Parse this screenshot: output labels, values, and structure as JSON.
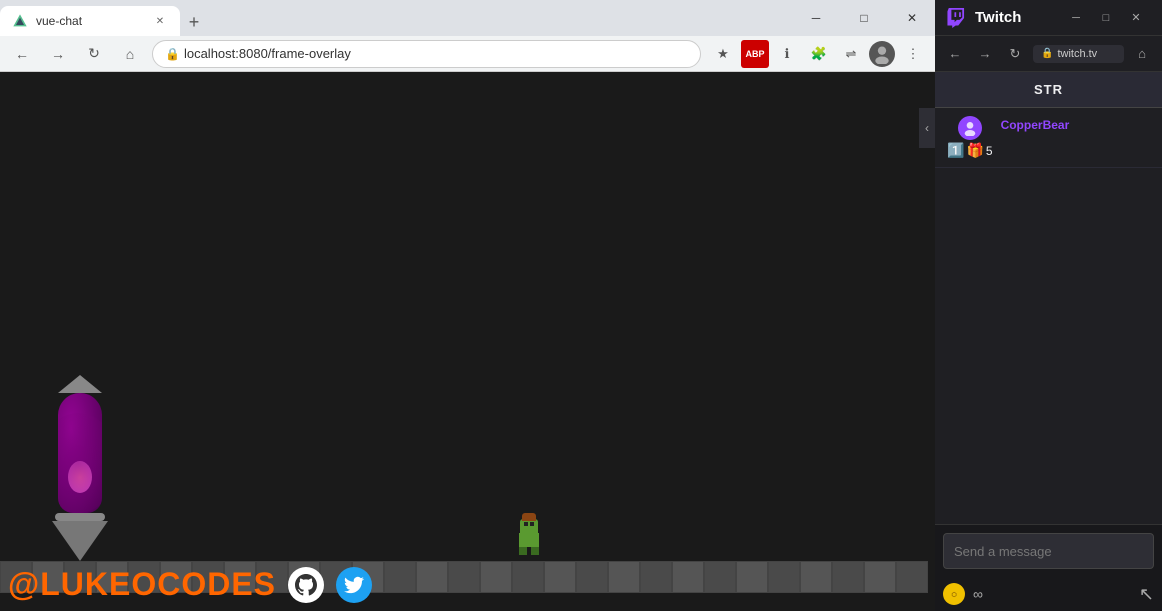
{
  "browser": {
    "tab_title": "vue-chat",
    "url": "localhost:8080/frame-overlay",
    "new_tab_label": "+",
    "window_controls": {
      "minimize": "─",
      "maximize": "□",
      "close": "✕"
    },
    "nav": {
      "back": "←",
      "forward": "→",
      "reload": "↻",
      "home": "⌂"
    },
    "toolbar": {
      "star": "★",
      "abp": "ABP",
      "info": "ℹ",
      "puzzle": "🧩",
      "menu": "⋮",
      "extensions": "🔧",
      "avatar": "👤"
    }
  },
  "game": {
    "branding": {
      "handle": "@LUKEOCODES"
    }
  },
  "twitch": {
    "title": "Twitch",
    "stream_label": "STR",
    "url": "twitch.tv",
    "chat": {
      "username": "CopperBear",
      "badge_count": "5",
      "input_placeholder": "Send a message"
    },
    "nav": {
      "back": "←",
      "forward": "→",
      "reload": "↻",
      "home": "⌂"
    }
  }
}
